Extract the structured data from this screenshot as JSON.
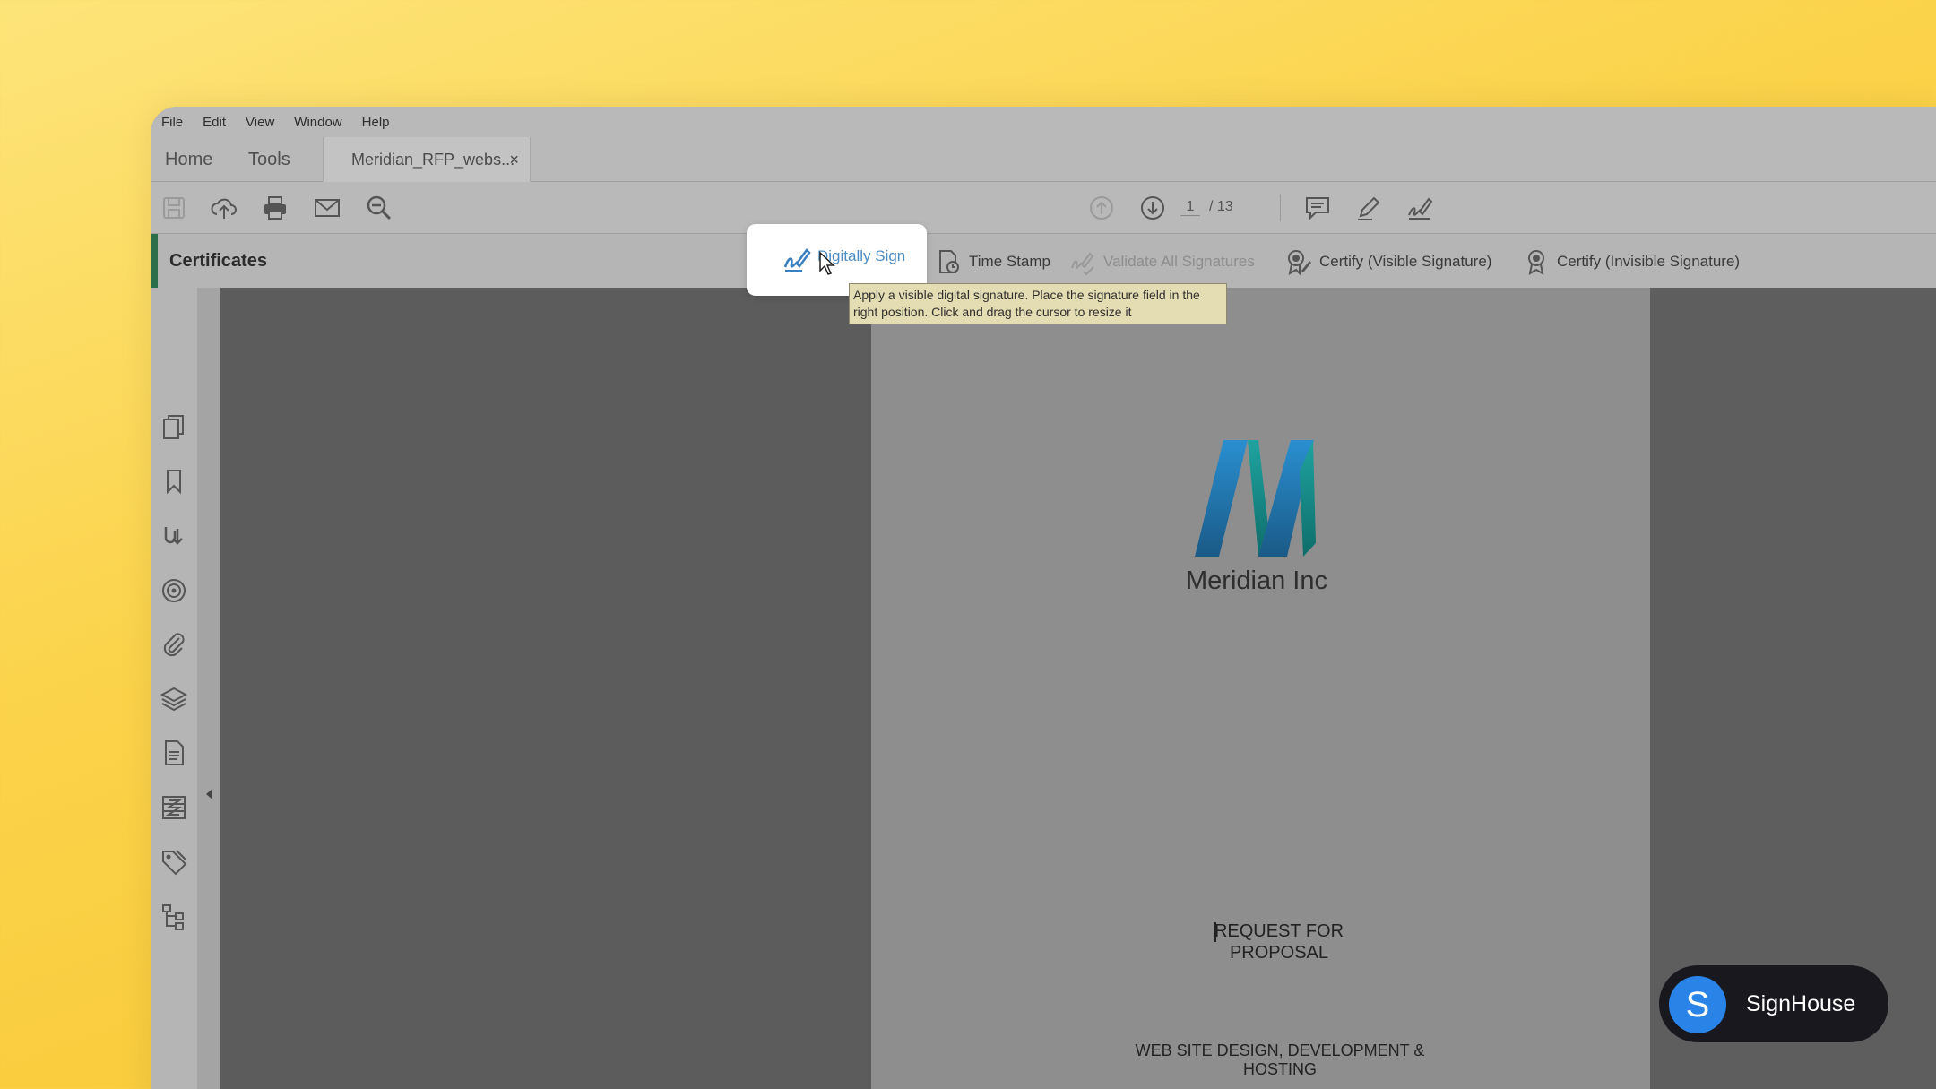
{
  "menu": [
    "File",
    "Edit",
    "View",
    "Window",
    "Help"
  ],
  "tabs": {
    "home": "Home",
    "tools": "Tools",
    "document": "Meridian_RFP_webs...",
    "close": "×"
  },
  "toolbar": {
    "page_current": "1",
    "page_total": "/ 13"
  },
  "certificates": {
    "title": "Certificates",
    "digitally_sign": "Digitally Sign",
    "time_stamp": "Time Stamp",
    "validate_all": "Validate All Signatures",
    "certify_visible": "Certify (Visible Signature)",
    "certify_invisible": "Certify (Invisible Signature)"
  },
  "tooltip": "Apply a visible digital signature. Place the signature field in the right position. Click and drag the cursor to resize it",
  "document": {
    "company": "Meridian Inc",
    "rfp_line1": "REQUEST FOR",
    "rfp_line2": "PROPOSAL",
    "subtitle": "WEB SITE DESIGN, DEVELOPMENT & HOSTING"
  },
  "badge": {
    "letter": "S",
    "name": "SignHouse"
  },
  "colors": {
    "accent_green": "#2d6e4a",
    "sign_blue": "#4b8cc5",
    "badge_blue": "#2a84e8"
  }
}
